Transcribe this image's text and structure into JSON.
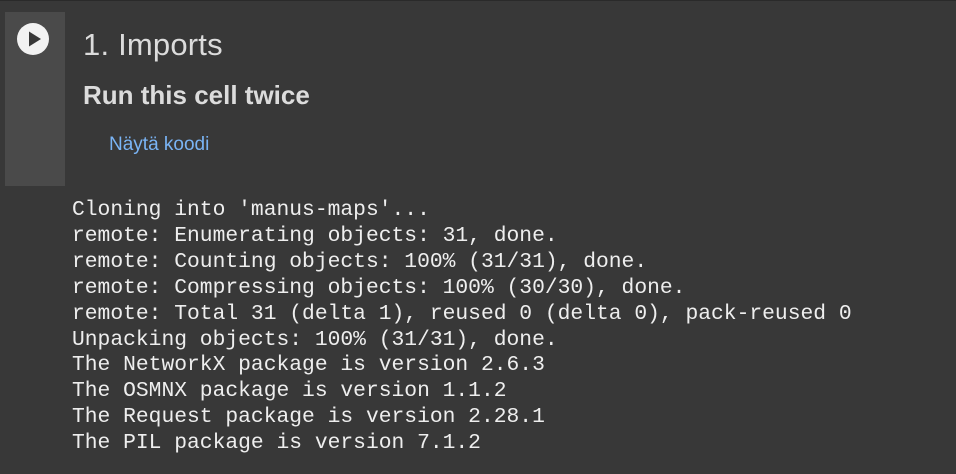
{
  "cell": {
    "title": "1. Imports",
    "subtitle": "Run this cell twice",
    "show_code_label": "Näytä koodi",
    "run_icon": "play-icon"
  },
  "output": {
    "lines": [
      "Cloning into 'manus-maps'...",
      "remote: Enumerating objects: 31, done.",
      "remote: Counting objects: 100% (31/31), done.",
      "remote: Compressing objects: 100% (30/30), done.",
      "remote: Total 31 (delta 1), reused 0 (delta 0), pack-reused 0",
      "Unpacking objects: 100% (31/31), done.",
      "The NetworkX package is version 2.6.3",
      "The OSMNX package is version 1.1.2",
      "The Request package is version 2.28.1",
      "The PIL package is version 7.1.2"
    ]
  },
  "colors": {
    "background": "#383838",
    "gutter": "#4a4a4a",
    "text": "#dcdcdc",
    "link": "#7ab4f5"
  }
}
